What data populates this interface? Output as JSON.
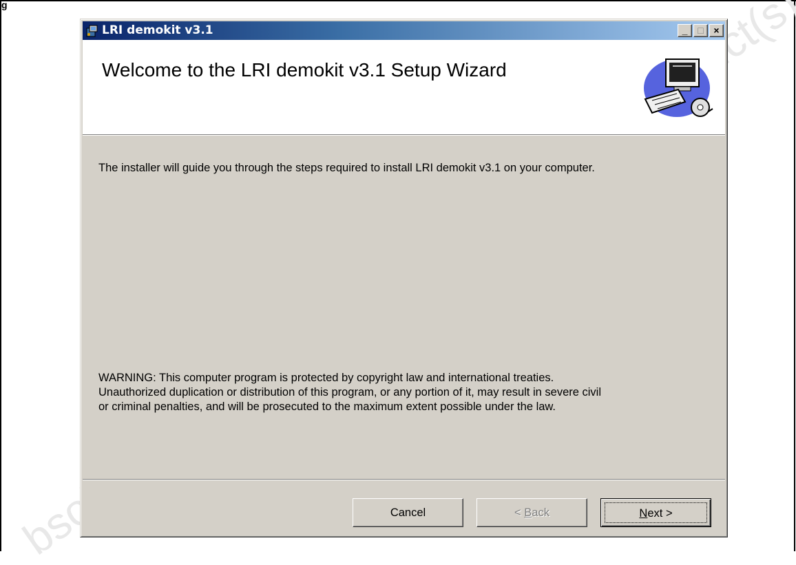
{
  "figure_label": "g",
  "watermark_fragments": [
    "bsol",
    "uct(s)"
  ],
  "window": {
    "title": "LRI demokit v3.1",
    "controls": {
      "minimize": "_",
      "maximize": "□",
      "close": "×"
    }
  },
  "header": {
    "welcome_title": "Welcome to the LRI demokit v3.1 Setup Wizard",
    "art_icon": "computer-setup-icon"
  },
  "body": {
    "intro_text": "The installer will guide you through the steps required to install LRI demokit v3.1 on your computer.",
    "warning_line1": "WARNING: This computer program is protected by copyright law and international treaties.",
    "warning_line2": "Unauthorized duplication or distribution of this program, or any portion of it, may result in severe civil",
    "warning_line3": "or criminal penalties, and will be prosecuted to the maximum extent possible under the law."
  },
  "buttons": {
    "cancel": "Cancel",
    "back_prefix": "< ",
    "back_accel": "B",
    "back_rest": "ack",
    "next_accel": "N",
    "next_rest": "ext >"
  },
  "colors": {
    "dialog_bg": "#d4d0c8",
    "titlebar_start": "#0a246a",
    "titlebar_end": "#a6caf0"
  }
}
